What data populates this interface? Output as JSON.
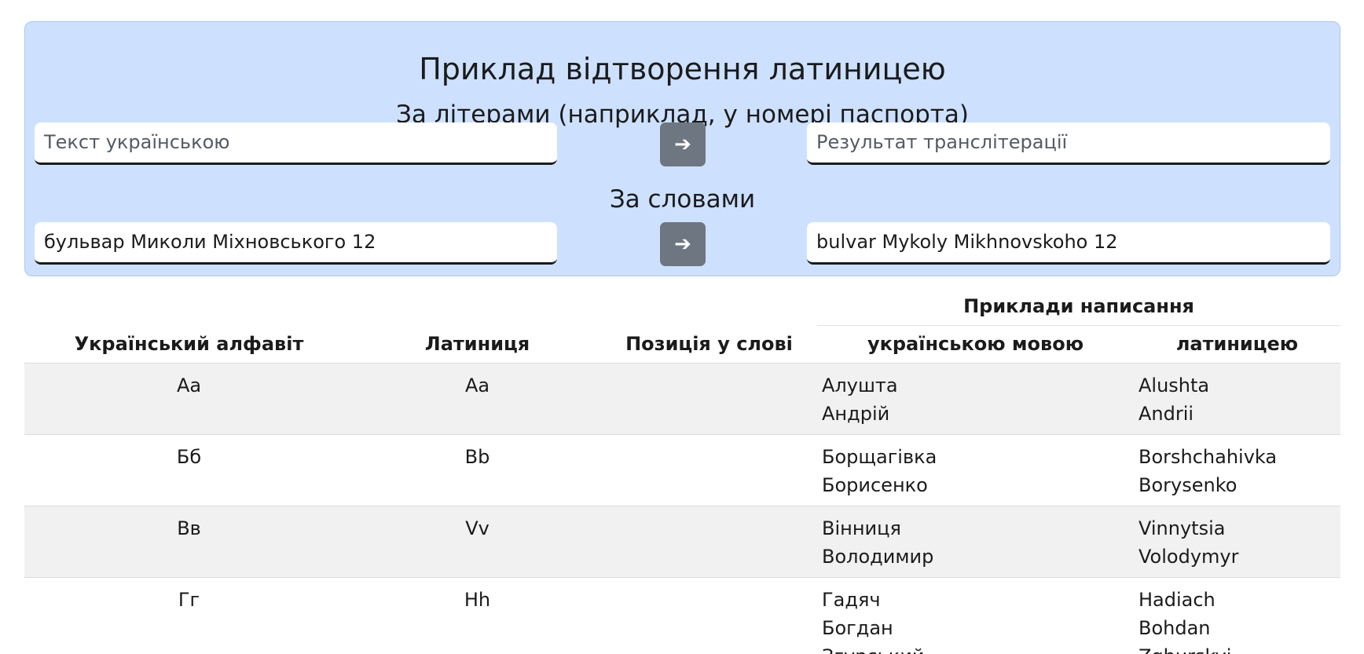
{
  "converter": {
    "title": "Приклад відтворення латиницею",
    "by_letters": {
      "heading": "За літерами (наприклад, у номері паспорта)",
      "input_placeholder": "Текст українською",
      "input_value": "",
      "output_placeholder": "Результат транслітерації",
      "output_value": "",
      "button_label": "➔"
    },
    "by_words": {
      "heading": "За словами",
      "input_value": "бульвар Миколи Міхновського 12",
      "output_value": "bulvar Mykoly Mikhnovskoho 12",
      "button_label": "➔"
    }
  },
  "table": {
    "group_header": "Приклади написання",
    "columns": [
      "Український алфавіт",
      "Латиниця",
      "Позиція у слові",
      "українською мовою",
      "латиницею"
    ],
    "rows": [
      {
        "ukr": "Аа",
        "lat": "Aa",
        "position": "",
        "examples_ukr": [
          "Алушта",
          "Андрій"
        ],
        "examples_lat": [
          "Alushta",
          "Andrii"
        ]
      },
      {
        "ukr": "Бб",
        "lat": "Bb",
        "position": "",
        "examples_ukr": [
          "Борщагівка",
          "Борисенко"
        ],
        "examples_lat": [
          "Borshchahivka",
          "Borysenko"
        ]
      },
      {
        "ukr": "Вв",
        "lat": "Vv",
        "position": "",
        "examples_ukr": [
          "Вінниця",
          "Володимир"
        ],
        "examples_lat": [
          "Vinnytsia",
          "Volodymyr"
        ]
      },
      {
        "ukr": "Гг",
        "lat": "Hh",
        "position": "",
        "examples_ukr": [
          "Гадяч",
          "Богдан",
          "Згурський"
        ],
        "examples_lat": [
          "Hadiach",
          "Bohdan",
          "Zghurskyi"
        ]
      }
    ]
  }
}
